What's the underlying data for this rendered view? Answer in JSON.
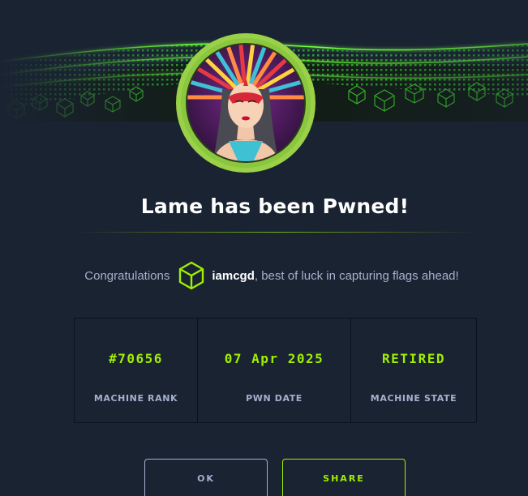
{
  "dialog": {
    "title": "Lame has been Pwned!",
    "congrats_prefix": "Congratulations",
    "username": "iamcgd",
    "congrats_suffix": ", best of luck in capturing flags ahead!"
  },
  "stats": [
    {
      "value": "#70656",
      "label": "MACHINE RANK"
    },
    {
      "value": "07 Apr 2025",
      "label": "PWN DATE"
    },
    {
      "value": "RETIRED",
      "label": "MACHINE STATE"
    }
  ],
  "buttons": {
    "ok_label": "OK",
    "share_label": "SHARE"
  },
  "icons": {
    "user_badge": "green-cube-icon",
    "avatar": "machine-avatar-headdress-woman"
  },
  "colors": {
    "background": "#1a2332",
    "accent": "#9fef00",
    "muted_text": "#a4b1cd",
    "avatar_ring": "#8ac73e"
  }
}
